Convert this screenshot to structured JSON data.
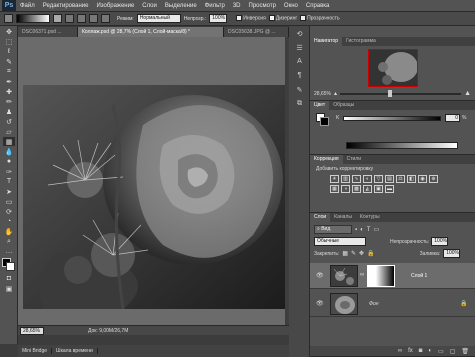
{
  "menubar": {
    "logo": "Ps",
    "items": [
      "Файл",
      "Редактирование",
      "Изображение",
      "Слои",
      "Выделение",
      "Фильтр",
      "3D",
      "Просмотр",
      "Окно",
      "Справка"
    ]
  },
  "options": {
    "mode_label": "Режим:",
    "mode_value": "Нормальный",
    "opacity_label": "Непрозр.:",
    "opacity_value": "100%",
    "reverse_label": "Инверсия",
    "dither_label": "Дизеринг",
    "transparency_label": "Прозрачность"
  },
  "document_tabs": [
    {
      "label": "DSC06371.psd ...",
      "active": false
    },
    {
      "label": "Коллаж.psd @ 28,7% (Слой 1, Слой-маска/8) *",
      "active": true
    },
    {
      "label": "DSC05638.JPG @ ...",
      "active": false
    }
  ],
  "status": {
    "zoom": "28,65%",
    "doc_info": "Док: 9,00M/26,7M"
  },
  "bottom_tabs": [
    "Mini Bridge",
    "Шкала времени"
  ],
  "navigator": {
    "tabs": [
      "Навигатор",
      "Гистограмма"
    ],
    "zoom": "28,65%"
  },
  "color": {
    "tabs": [
      "Цвет",
      "Образцы"
    ],
    "channel": "K",
    "value": "0",
    "unit": "%"
  },
  "adjustments": {
    "tabs": [
      "Коррекция",
      "Стили"
    ],
    "title": "Добавить корректировку"
  },
  "layers": {
    "tabs": [
      "Слои",
      "Каналы",
      "Контуры"
    ],
    "filter_label": "Вид",
    "blend_mode": "Обычные",
    "opacity_label": "Непрозрачность:",
    "opacity_value": "100%",
    "lock_label": "Закрепить:",
    "fill_label": "Заливка:",
    "fill_value": "100%",
    "items": [
      {
        "name": "Слой 1",
        "selected": true
      },
      {
        "name": "Фон",
        "selected": false
      }
    ]
  },
  "colors": {
    "app_bg": "#535353",
    "canvas_bg": "#6b6b6b",
    "active_tab": "#737373"
  }
}
